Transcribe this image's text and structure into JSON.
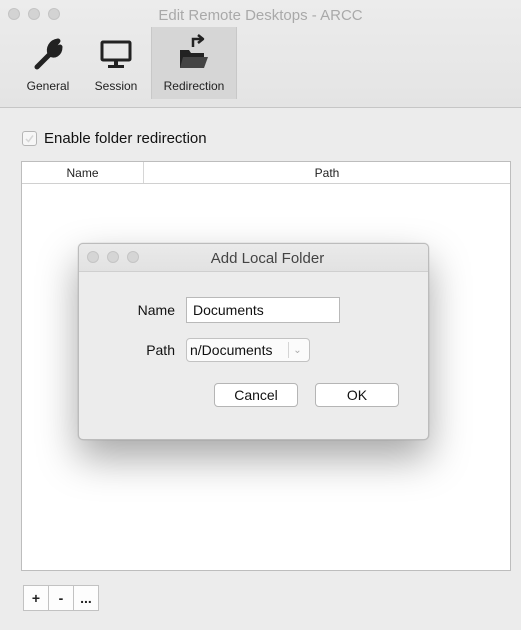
{
  "window": {
    "title": "Edit Remote Desktops - ARCC"
  },
  "toolbar": {
    "items": [
      {
        "label": "General",
        "icon": "wrench-icon"
      },
      {
        "label": "Session",
        "icon": "monitor-icon"
      },
      {
        "label": "Redirection",
        "icon": "folder-redirect-icon",
        "selected": true
      }
    ]
  },
  "content": {
    "enable_label": "Enable folder redirection",
    "enable_checked": false,
    "table": {
      "columns": [
        "Name",
        "Path"
      ],
      "rows": []
    },
    "bottom_buttons": [
      "+",
      "-",
      "..."
    ]
  },
  "dialog": {
    "title": "Add Local Folder",
    "name_label": "Name",
    "name_value": "Documents",
    "path_label": "Path",
    "path_value": "n/Documents",
    "cancel_label": "Cancel",
    "ok_label": "OK"
  }
}
